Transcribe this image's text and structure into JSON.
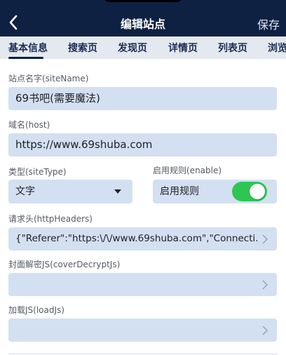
{
  "header": {
    "title": "编辑站点",
    "save_label": "保存",
    "back_icon": "chevron-left-icon"
  },
  "tabs": [
    {
      "label": "基本信息",
      "active": true
    },
    {
      "label": "搜索页",
      "active": false
    },
    {
      "label": "发现页",
      "active": false
    },
    {
      "label": "详情页",
      "active": false
    },
    {
      "label": "列表页",
      "active": false
    },
    {
      "label": "浏览",
      "active": false
    }
  ],
  "form": {
    "site_name": {
      "label": "站点名字(siteName)",
      "value": "69书吧(需要魔法)"
    },
    "host": {
      "label": "域名(host)",
      "value": "https://www.69shuba.com"
    },
    "site_type": {
      "label": "类型(siteType)",
      "value": "文字"
    },
    "enable": {
      "label": "启用规则(enable)",
      "toggle_label": "启用规则",
      "on": true
    },
    "http_headers": {
      "label": "请求头(httpHeaders)",
      "value": "{\"Referer\":\"https:\\/\\/www.69shuba.com\",\"Connecti..."
    },
    "cover_decrypt": {
      "label": "封面解密JS(coverDecryptJs)",
      "value": ""
    },
    "load_js": {
      "label": "加载JS(loadJs)",
      "value": ""
    }
  },
  "colors": {
    "header_bg": "#0e2142",
    "tab_bar_bg": "#e4e8ef",
    "field_bg": "#d3e0f1",
    "toggle_on": "#2dc653"
  }
}
